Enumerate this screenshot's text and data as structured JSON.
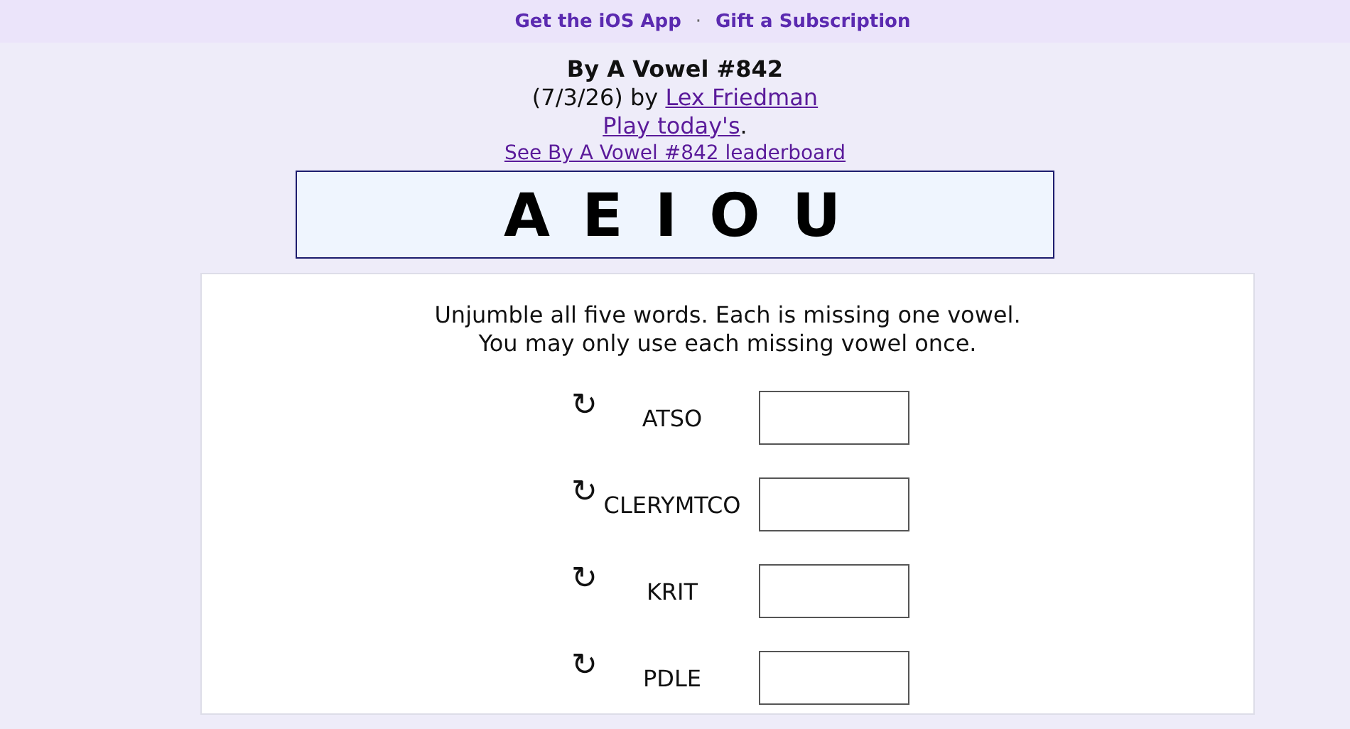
{
  "top_bar": {
    "links": [
      "Get the iOS App",
      "Gift a Subscription"
    ],
    "separator": "·"
  },
  "header": {
    "title": "By A Vowel #842",
    "date": "(7/3/26) by",
    "author": "Lex Friedman",
    "play_link": "Play today's",
    "play_suffix": ".",
    "leaderboard_link": "See By A Vowel #842 leaderboard"
  },
  "vowels": "A E I O U",
  "instructions": [
    "Unjumble all five words. Each is missing one vowel.",
    "You may only use each missing vowel once."
  ],
  "puzzles": [
    {
      "shuffle": "↻",
      "word": "ATSO"
    },
    {
      "shuffle": "↻",
      "word": "CLERYMTCO"
    },
    {
      "shuffle": "↻",
      "word": "KRIT"
    },
    {
      "shuffle": "↻",
      "word": "PDLE"
    }
  ]
}
